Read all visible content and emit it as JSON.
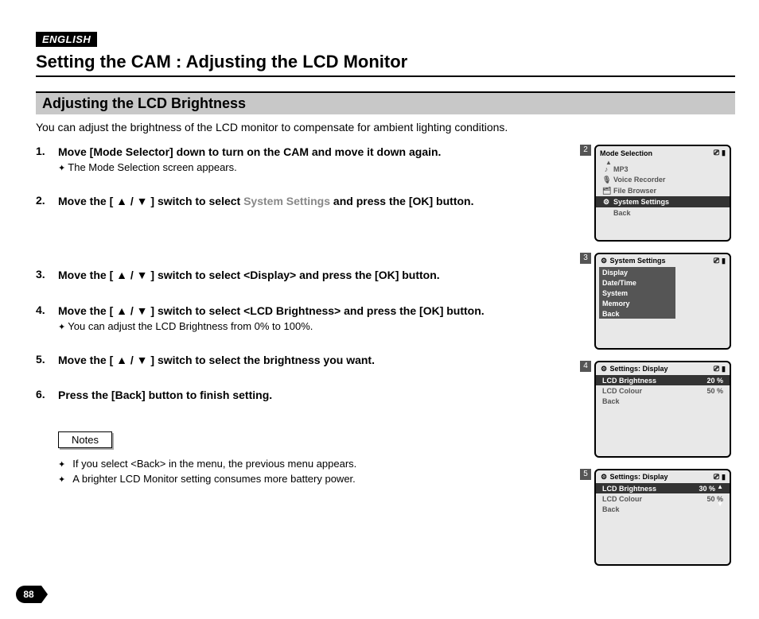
{
  "language_badge": "ENGLISH",
  "page_title": "Setting the CAM : Adjusting the LCD Monitor",
  "section_title": "Adjusting the LCD Brightness",
  "intro": "You can adjust the brightness of the LCD monitor to compensate for ambient lighting conditions.",
  "steps": [
    {
      "main": "Move [Mode Selector] down to turn on the CAM and move it down again.",
      "sub": "The Mode Selection screen appears."
    },
    {
      "main_pre": "Move the [ ▲ / ▼ ] switch to select ",
      "main_light": "System Settings",
      "main_post": " and press the [OK] button."
    },
    {
      "main": "Move the [ ▲ / ▼ ] switch to select <Display> and press the [OK] button."
    },
    {
      "main": "Move the [ ▲ / ▼ ] switch to select <LCD Brightness> and press the [OK] button.",
      "sub": "You can adjust the LCD Brightness from 0% to 100%."
    },
    {
      "main": "Move the [ ▲ / ▼ ] switch to select the brightness you want."
    },
    {
      "main": "Press the [Back] button to finish setting."
    }
  ],
  "notes_label": "Notes",
  "notes": [
    "If you select <Back> in the menu, the previous menu appears.",
    "A brighter LCD Monitor setting consumes more battery power."
  ],
  "screens": {
    "s2": {
      "num": "2",
      "title": "Mode Selection",
      "items": [
        {
          "icon": "♪",
          "label": "MP3",
          "sel": false
        },
        {
          "icon": "🎙",
          "label": "Voice Recorder",
          "sel": false
        },
        {
          "icon": "🗂",
          "label": "File Browser",
          "sel": false
        },
        {
          "icon": "⚙",
          "label": "System Settings",
          "sel": true
        },
        {
          "icon": "",
          "label": "Back",
          "sel": false
        }
      ]
    },
    "s3": {
      "num": "3",
      "title_icon": "⚙",
      "title": "System Settings",
      "items": [
        {
          "label": "Display",
          "sel": true
        },
        {
          "label": "Date/Time",
          "sel": true
        },
        {
          "label": "System",
          "sel": true
        },
        {
          "label": "Memory",
          "sel": true
        },
        {
          "label": "Back",
          "sel": true
        }
      ]
    },
    "s4": {
      "num": "4",
      "title_icon": "⚙",
      "title": "Settings: Display",
      "rows": [
        {
          "label": "LCD Brightness",
          "value": "20 %",
          "sel": true
        },
        {
          "label": "LCD Colour",
          "value": "50 %",
          "sel": false
        },
        {
          "label": "Back",
          "value": "",
          "sel": false
        }
      ]
    },
    "s5": {
      "num": "5",
      "title_icon": "⚙",
      "title": "Settings: Display",
      "rows": [
        {
          "label": "LCD Brightness",
          "value": "30 %",
          "sel": true
        },
        {
          "label": "LCD Colour",
          "value": "50 %",
          "sel": false
        },
        {
          "label": "Back",
          "value": "",
          "sel": false
        }
      ]
    }
  },
  "page_number": "88"
}
